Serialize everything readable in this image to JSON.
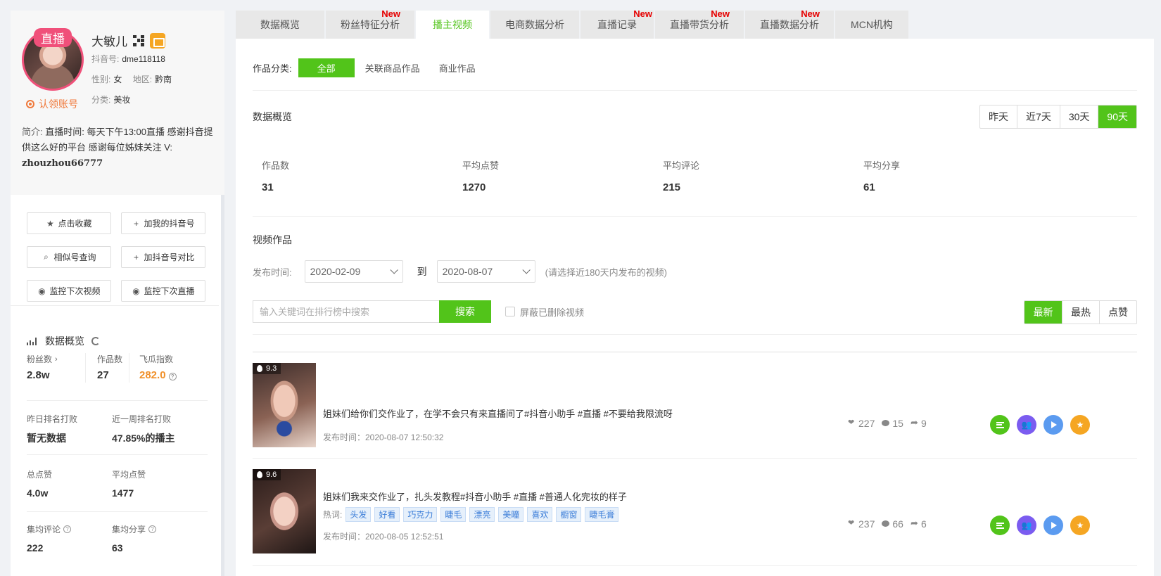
{
  "profile": {
    "live_badge": "直播",
    "name": "大敏儿",
    "douyin_label": "抖音号:",
    "douyin_id": "dme118118",
    "gender_label": "性别:",
    "gender": "女",
    "region_label": "地区:",
    "region": "黔南",
    "category_label": "分类:",
    "category": "美妆",
    "claim": "认领账号",
    "intro_label": "简介:",
    "intro_text": "直播时间: 每天下午13:00直播 感谢抖音提供这么好的平台 感谢每位姊妹关注 V:",
    "intro_wechat": "zhouzhou66777"
  },
  "side_buttons": [
    {
      "icon": "★",
      "label": "点击收藏"
    },
    {
      "icon": "+",
      "label": "加我的抖音号"
    },
    {
      "icon": "⌕",
      "label": "相似号查询"
    },
    {
      "icon": "+",
      "label": "加抖音号对比"
    },
    {
      "icon": "◉",
      "label": "监控下次视频"
    },
    {
      "icon": "◉",
      "label": "监控下次直播"
    }
  ],
  "side_overview": {
    "title": "数据概览",
    "fans_label": "粉丝数",
    "fans": "2.8w",
    "works_label": "作品数",
    "works": "27",
    "feigua_label": "飞瓜指数",
    "feigua": "282.0",
    "rank_yesterday_label": "昨日排名打败",
    "rank_yesterday": "暂无数据",
    "rank_week_label": "近一周排名打败",
    "rank_week": "47.85%的播主",
    "total_likes_label": "总点赞",
    "total_likes": "4.0w",
    "avg_likes_label": "平均点赞",
    "avg_likes": "1477",
    "avg_comments_label": "集均评论",
    "avg_comments": "222",
    "avg_shares_label": "集均分享",
    "avg_shares": "63"
  },
  "tabs": [
    {
      "label": "数据概览",
      "new": ""
    },
    {
      "label": "粉丝特征分析",
      "new": "New"
    },
    {
      "label": "播主视频",
      "new": ""
    },
    {
      "label": "电商数据分析",
      "new": ""
    },
    {
      "label": "直播记录",
      "new": "New"
    },
    {
      "label": "直播带货分析",
      "new": "New"
    },
    {
      "label": "直播数据分析",
      "new": "New"
    },
    {
      "label": "MCN机构",
      "new": ""
    }
  ],
  "filter": {
    "label": "作品分类:",
    "options": [
      "全部",
      "关联商品作品",
      "商业作品"
    ]
  },
  "overview": {
    "title": "数据概览",
    "periods": [
      "昨天",
      "近7天",
      "30天",
      "90天"
    ],
    "kpis": [
      {
        "label": "作品数",
        "value": "31"
      },
      {
        "label": "平均点赞",
        "value": "1270"
      },
      {
        "label": "平均评论",
        "value": "215"
      },
      {
        "label": "平均分享",
        "value": "61"
      }
    ]
  },
  "videos_section": {
    "title": "视频作品",
    "date_label": "发布时间:",
    "date_from": "2020-02-09",
    "date_to_label": "到",
    "date_to": "2020-08-07",
    "date_hint": "(请选择近180天内发布的视频)",
    "search_placeholder": "输入关键词在排行榜中搜索",
    "search_button": "搜索",
    "hide_deleted": "屏蔽已删除视频",
    "sort": [
      "最新",
      "最热",
      "点赞"
    ]
  },
  "videos": [
    {
      "score": "9.3",
      "title": "姐妹们给你们交作业了，在学不会只有来直播间了#抖音小助手 #直播 #不要给我限流呀",
      "time": "发布时间：2020-08-07 12:50:32",
      "likes": "227",
      "comments": "15",
      "shares": "9"
    },
    {
      "score": "9.6",
      "title": "姐妹们我来交作业了，扎头发教程#抖音小助手 #直播 #普通人化完妆的样子",
      "hot_label": "热词:",
      "tags": [
        "头发",
        "好看",
        "巧克力",
        "睫毛",
        "漂亮",
        "美瞳",
        "喜欢",
        "橱窗",
        "睫毛膏"
      ],
      "time": "发布时间：2020-08-05 12:52:51",
      "likes": "237",
      "comments": "66",
      "shares": "6"
    }
  ]
}
